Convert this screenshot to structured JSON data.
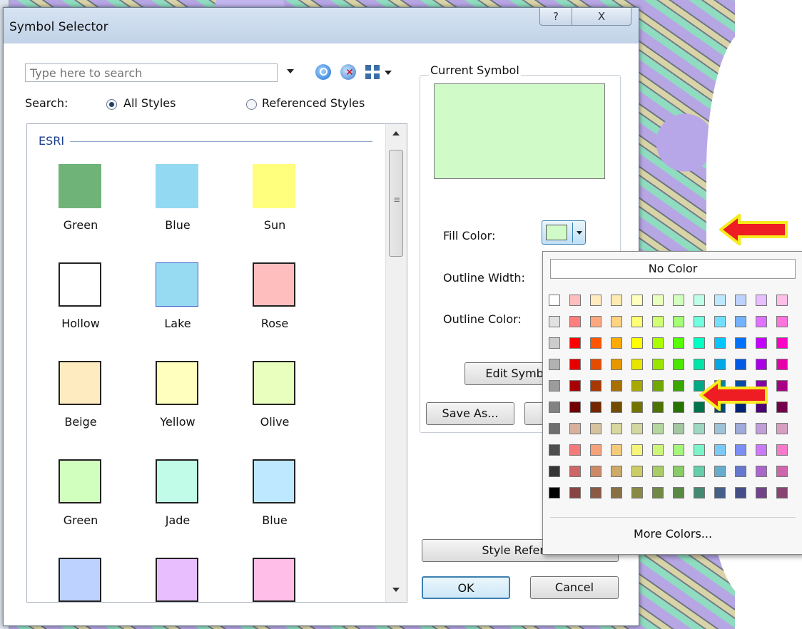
{
  "window": {
    "title": "Symbol Selector",
    "help_glyph": "?",
    "close_glyph": "X"
  },
  "search": {
    "placeholder": "Type here to search",
    "label": "Search:",
    "option_all": "All Styles",
    "option_referenced": "Referenced Styles",
    "selected": "All Styles"
  },
  "gallery": {
    "group": "ESRI",
    "symbols": [
      {
        "label": "Green",
        "color": "#70b378"
      },
      {
        "label": "Blue",
        "color": "#93d9f1"
      },
      {
        "label": "Sun",
        "color": "#fffe7d"
      },
      {
        "label": "Hollow",
        "color": "#ffffff"
      },
      {
        "label": "Lake",
        "color": "#97dbf2"
      },
      {
        "label": "Rose",
        "color": "#ffbebe"
      },
      {
        "label": "Beige",
        "color": "#ffebc0"
      },
      {
        "label": "Yellow",
        "color": "#ffffbe"
      },
      {
        "label": "Olive",
        "color": "#e9ffbe"
      },
      {
        "label": "Green",
        "color": "#d1ffbe"
      },
      {
        "label": "Jade",
        "color": "#c0fce8"
      },
      {
        "label": "Blue",
        "color": "#bee8ff"
      },
      {
        "label": "",
        "color": "#bed2ff"
      },
      {
        "label": "",
        "color": "#e8beff"
      },
      {
        "label": "",
        "color": "#ffbee8"
      }
    ]
  },
  "current_symbol": {
    "title": "Current Symbol",
    "fill_color": "#d1fac9",
    "fill_label": "Fill Color:",
    "outline_width_label": "Outline Width:",
    "outline_color_label": "Outline Color:",
    "edit_button": "Edit Symbo",
    "save_as_button": "Save As..."
  },
  "buttons": {
    "style_references": "Style Referen",
    "ok": "OK",
    "cancel": "Cancel"
  },
  "color_palette": {
    "no_color": "No Color",
    "more_colors": "More Colors...",
    "rows": [
      [
        "#ffffff",
        "#ffbebe",
        "#ffebbe",
        "#ffebaf",
        "#ffffbe",
        "#e9ffbe",
        "#d3ffbe",
        "#befee8",
        "#bee8ff",
        "#bed2ff",
        "#e8beff",
        "#ffbee8"
      ],
      [
        "#e1e1e1",
        "#ff7f7f",
        "#ffa77f",
        "#ffd37f",
        "#ffff73",
        "#d1ff73",
        "#a3ff73",
        "#73ffdf",
        "#73dfff",
        "#73b2ff",
        "#df73ff",
        "#ff73df"
      ],
      [
        "#cccccc",
        "#ff0000",
        "#ff5500",
        "#ffaa00",
        "#ffff00",
        "#aaff00",
        "#55ff00",
        "#00ffc5",
        "#00c5ff",
        "#0070ff",
        "#c500ff",
        "#ff00c5"
      ],
      [
        "#b2b2b2",
        "#e60000",
        "#e64c00",
        "#e69800",
        "#e6e600",
        "#98e600",
        "#4ce600",
        "#00e6a9",
        "#00a9e6",
        "#005ce6",
        "#a900e6",
        "#e600a9"
      ],
      [
        "#9c9c9c",
        "#a80000",
        "#a83800",
        "#a87000",
        "#a8a800",
        "#70a800",
        "#38a800",
        "#00a884",
        "#0084a8",
        "#004da8",
        "#8400a8",
        "#a80084"
      ],
      [
        "#828282",
        "#730000",
        "#732600",
        "#734c00",
        "#737300",
        "#4c7300",
        "#267300",
        "#00734c",
        "#004c73",
        "#002673",
        "#4c0073",
        "#73004c"
      ],
      [
        "#6e6e6e",
        "#d7b09e",
        "#d7c29e",
        "#d7d79e",
        "#d3d7a0",
        "#b4d79e",
        "#a3c7a0",
        "#9ed7c2",
        "#9ec2d7",
        "#9eaad7",
        "#c29ed7",
        "#d79ec2"
      ],
      [
        "#4e4e4e",
        "#f57a7a",
        "#f5a27a",
        "#f5ca7a",
        "#f5f57a",
        "#cdf57a",
        "#a5f57a",
        "#7af5ca",
        "#7acaf5",
        "#7a8ef5",
        "#ca7af5",
        "#f57aca"
      ],
      [
        "#343434",
        "#cd6666",
        "#cd8966",
        "#cdaa66",
        "#cdcd66",
        "#a8cd66",
        "#89cd66",
        "#66cdab",
        "#66adcd",
        "#6677cd",
        "#ab66cd",
        "#cd66ab"
      ],
      [
        "#000000",
        "#894444",
        "#895a44",
        "#897144",
        "#898944",
        "#718944",
        "#5a8944",
        "#448971",
        "#445f89",
        "#444f89",
        "#714489",
        "#894471"
      ]
    ]
  },
  "annotations": {
    "arrow_color": "#ee1d23",
    "arrow_outline": "#f7ea1d"
  }
}
